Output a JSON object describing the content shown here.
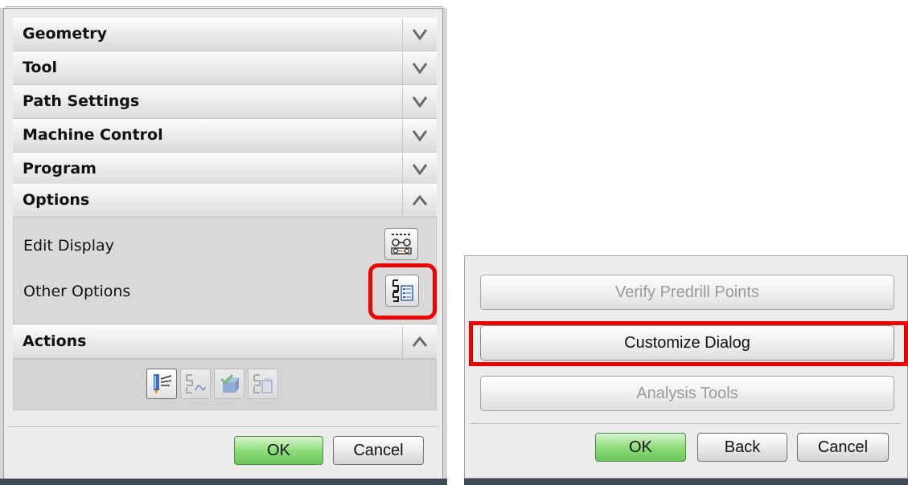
{
  "left_dialog": {
    "groups": [
      {
        "label": "Geometry",
        "state": "collapsed"
      },
      {
        "label": "Tool",
        "state": "collapsed"
      },
      {
        "label": "Path Settings",
        "state": "collapsed"
      },
      {
        "label": "Machine Control",
        "state": "collapsed"
      },
      {
        "label": "Program",
        "state": "collapsed"
      },
      {
        "label": "Options",
        "state": "expanded"
      }
    ],
    "options": {
      "edit_display_label": "Edit Display",
      "other_options_label": "Other Options"
    },
    "actions": {
      "label": "Actions",
      "state": "expanded",
      "buttons": [
        {
          "icon": "generate-icon",
          "enabled": true
        },
        {
          "icon": "replay-icon",
          "enabled": false
        },
        {
          "icon": "verify-icon",
          "enabled": false
        },
        {
          "icon": "list-icon",
          "enabled": false
        }
      ]
    },
    "footer": {
      "ok_label": "OK",
      "cancel_label": "Cancel"
    }
  },
  "right_dialog": {
    "verify_predrill_label": "Verify Predrill Points",
    "customize_dialog_label": "Customize Dialog",
    "analysis_tools_label": "Analysis Tools",
    "footer": {
      "ok_label": "OK",
      "back_label": "Back",
      "cancel_label": "Cancel"
    }
  },
  "colors": {
    "highlight": "#ee0000",
    "ok_green": "#8fdc7c",
    "title_bar_dark": "#3f4a57"
  }
}
